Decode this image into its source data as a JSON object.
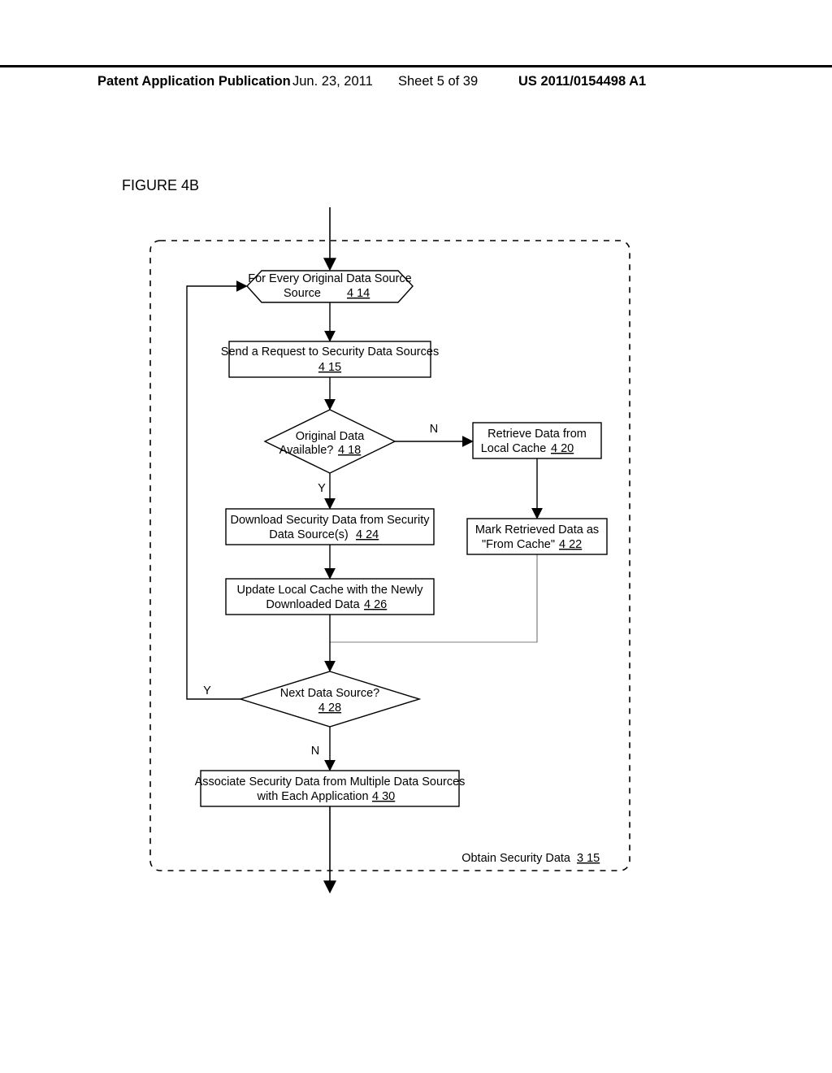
{
  "header": {
    "left": "Patent Application Publication",
    "date": "Jun. 23, 2011",
    "sheet": "Sheet 5 of 39",
    "pubno": "US 2011/0154498 A1"
  },
  "figure_label": "FIGURE 4B",
  "container": {
    "label_text": "Obtain Security Data",
    "label_ref": "3 15"
  },
  "nodes": {
    "n414": {
      "text": "For Every Original Data Source",
      "ref": "4 14"
    },
    "n415": {
      "text": "Send a Request to Security Data Sources",
      "ref": "4 15"
    },
    "n418": {
      "text": "Original Data Available?",
      "ref": "4 18"
    },
    "n420": {
      "text1": "Retrieve Data from",
      "text2": "Local Cache",
      "ref": "4 20"
    },
    "n422": {
      "text1": "Mark Retrieved Data as",
      "text2": "\"From Cache\"",
      "ref": "4 22"
    },
    "n424": {
      "text1": "Download Security Data from Security",
      "text2": "Data Source(s)",
      "ref": "4 24"
    },
    "n426": {
      "text1": "Update Local Cache  with the Newly",
      "text2": "Downloaded  Data",
      "ref": "4 26"
    },
    "n428": {
      "text": "Next  Data Source?",
      "ref": "4 28"
    },
    "n430": {
      "text1": "Associate Security Data from Multiple Data Sources",
      "text2": "with Each Application",
      "ref": "4 30"
    }
  },
  "labels": {
    "yes": "Y",
    "no": "N"
  }
}
